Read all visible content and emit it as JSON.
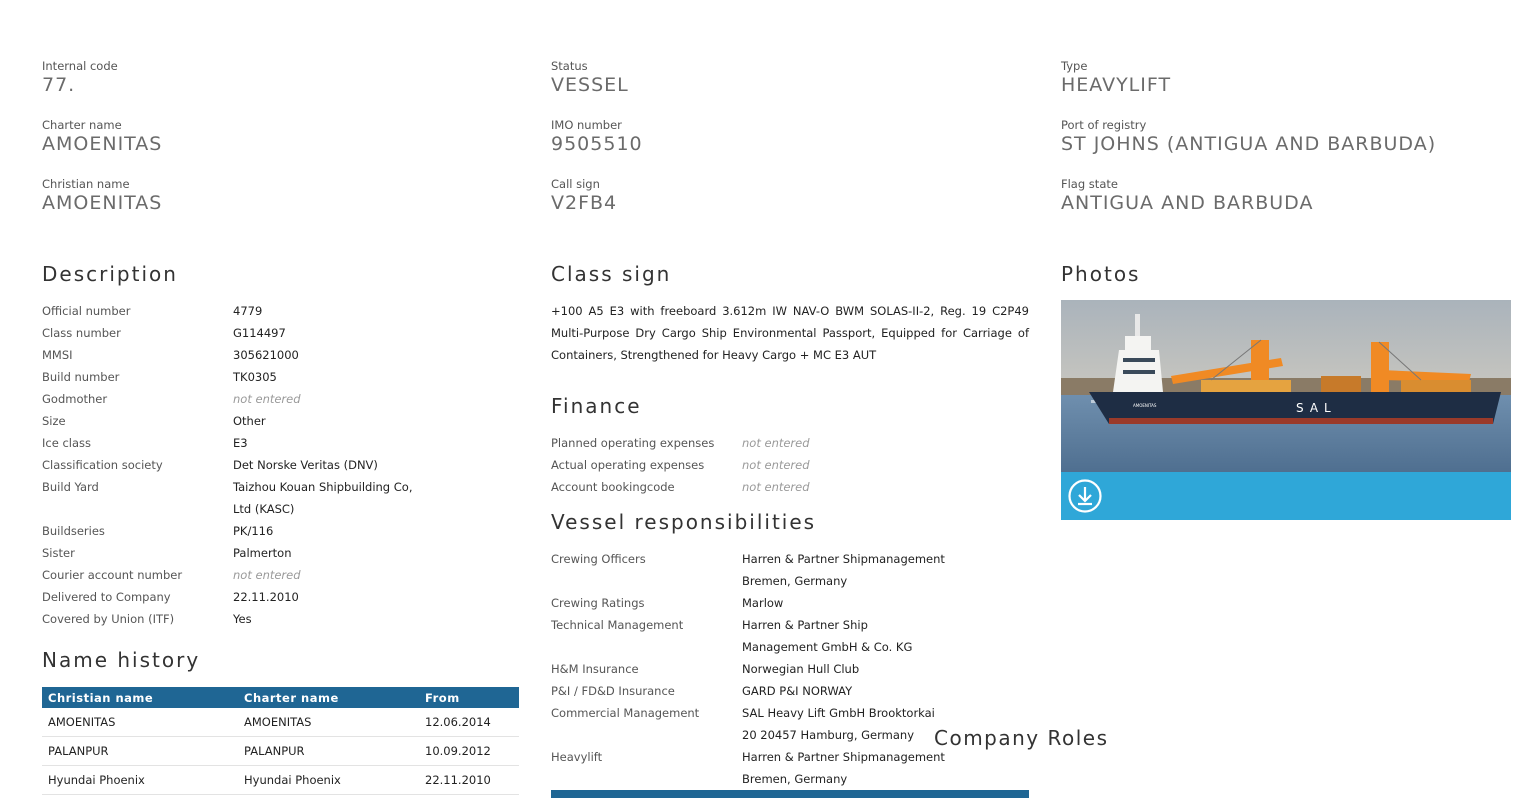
{
  "fields": {
    "internal_code": {
      "label": "Internal code",
      "value": "77."
    },
    "status": {
      "label": "Status",
      "value": "VESSEL"
    },
    "type": {
      "label": "Type",
      "value": "HEAVYLIFT"
    },
    "charter_name": {
      "label": "Charter name",
      "value": "AMOENITAS"
    },
    "imo_number": {
      "label": "IMO number",
      "value": "9505510"
    },
    "port_of_registry": {
      "label": "Port of registry",
      "value": "ST JOHNS (ANTIGUA AND BARBUDA)"
    },
    "christian_name": {
      "label": "Christian name",
      "value": "AMOENITAS"
    },
    "call_sign": {
      "label": "Call sign",
      "value": "V2FB4"
    },
    "flag_state": {
      "label": "Flag state",
      "value": "ANTIGUA AND BARBUDA"
    }
  },
  "description": {
    "title": "Description",
    "rows": [
      {
        "label": "Official number",
        "value": "4779"
      },
      {
        "label": "Class number",
        "value": "G114497"
      },
      {
        "label": "MMSI",
        "value": "305621000"
      },
      {
        "label": "Build number",
        "value": "TK0305"
      },
      {
        "label": "Godmother",
        "value": "not entered"
      },
      {
        "label": "Size",
        "value": "Other"
      },
      {
        "label": "Ice class",
        "value": "E3"
      },
      {
        "label": "Classification society",
        "value": "Det Norske Veritas (DNV)"
      },
      {
        "label": "Build Yard",
        "value": "Taizhou Kouan Shipbuilding Co, Ltd (KASC)"
      },
      {
        "label": "Buildseries",
        "value": "PK/116"
      },
      {
        "label": "Sister",
        "value": "Palmerton"
      },
      {
        "label": "Courier account number",
        "value": "not entered"
      },
      {
        "label": "Delivered to Company",
        "value": "22.11.2010"
      },
      {
        "label": "Covered by Union (ITF)",
        "value": "Yes"
      }
    ]
  },
  "name_history": {
    "title": "Name history",
    "columns": [
      "Christian name",
      "Charter name",
      "From"
    ],
    "rows": [
      [
        "AMOENITAS",
        "AMOENITAS",
        "12.06.2014"
      ],
      [
        "PALANPUR",
        "PALANPUR",
        "10.09.2012"
      ],
      [
        "Hyundai Phoenix",
        "Hyundai Phoenix",
        "22.11.2010"
      ]
    ]
  },
  "class_sign": {
    "title": "Class sign",
    "text": "+100 A5 E3 with freeboard 3.612m IW NAV-O BWM SOLAS-II-2, Reg. 19 C2P49 Multi-Purpose Dry Cargo Ship Environmental Passport, Equipped for Carriage of Containers, Strengthened for Heavy Cargo + MC E3 AUT"
  },
  "finance": {
    "title": "Finance",
    "rows": [
      {
        "label": "Planned operating expenses",
        "value": "not entered"
      },
      {
        "label": "Actual operating expenses",
        "value": "not entered"
      },
      {
        "label": "Account bookingcode",
        "value": "not entered"
      }
    ]
  },
  "responsibilities": {
    "title": "Vessel responsibilities",
    "rows": [
      {
        "label": "Crewing Officers",
        "value": "Harren & Partner Shipmanagement Bremen, Germany"
      },
      {
        "label": "Crewing Ratings",
        "value": "Marlow"
      },
      {
        "label": "Technical Management",
        "value": "Harren & Partner Ship Management GmbH & Co. KG"
      },
      {
        "label": "H&M Insurance",
        "value": "Norwegian Hull Club"
      },
      {
        "label": "P&I / FD&D Insurance",
        "value": "GARD P&I NORWAY"
      },
      {
        "label": "Commercial Management",
        "value": "SAL Heavy Lift GmbH Brooktorkai 20 20457 Hamburg, Germany"
      },
      {
        "label": "Heavylift",
        "value": "Harren & Partner Shipmanagement Bremen, Germany"
      }
    ]
  },
  "photos": {
    "title": "Photos",
    "ship_hull_text": "SAL",
    "ship_name_text": "AMOENITAS",
    "download_icon": "download-circle-icon",
    "bar_color": "#2fa7d8"
  },
  "company_roles": {
    "title": "Company Roles"
  }
}
